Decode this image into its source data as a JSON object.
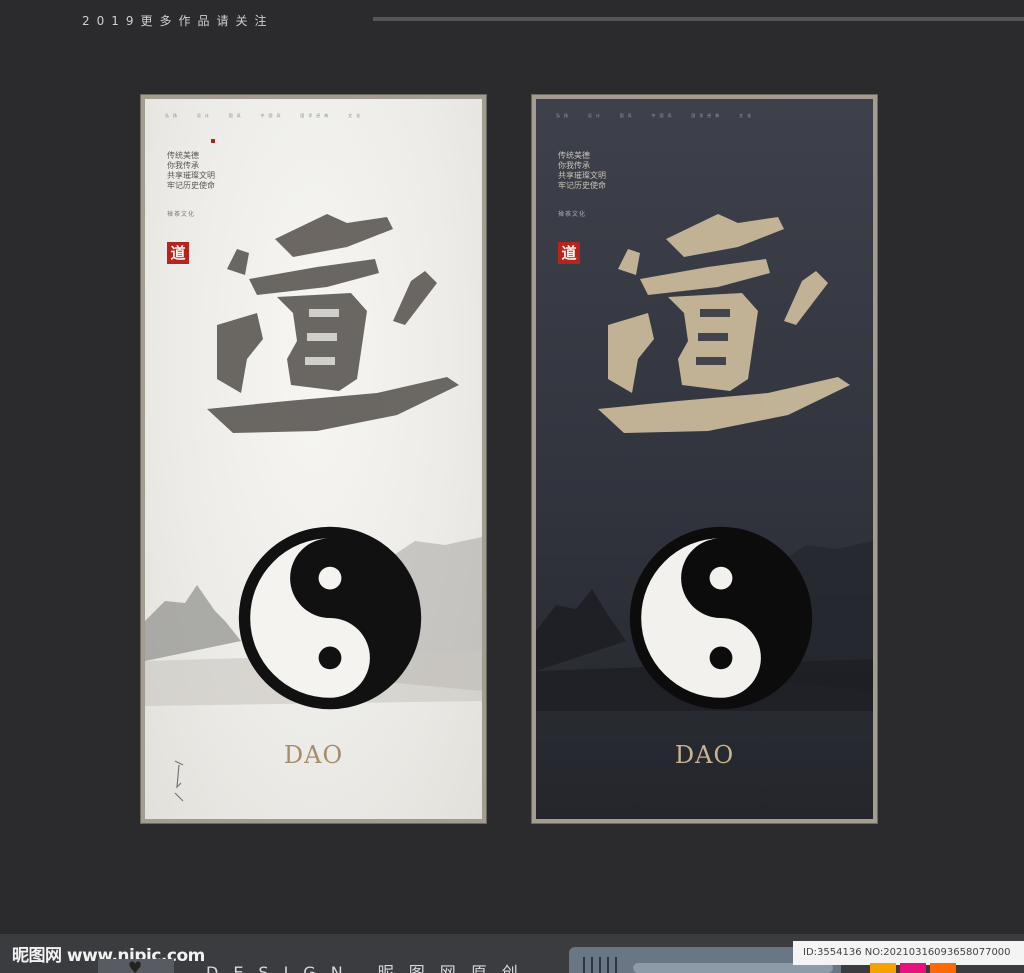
{
  "header": {
    "title": "2019更多作品请关注"
  },
  "posters": {
    "meta": "弘扬 · 设计 · 国风 · 中国风 · 国学经典 · 文化",
    "poem": [
      "传统美德",
      "你我传承",
      "共享璀璨文明",
      "牢记历史使命"
    ],
    "culture": "禅茶文化",
    "seal": "道",
    "big_glyph": "道",
    "title": "DAO",
    "colors": {
      "light_bg": "#ecebe7",
      "dark_bg": "#31343d",
      "seal_red": "#b8231d",
      "gold": "#c8b48f"
    }
  },
  "footer": {
    "brand": "昵图网 www.nipic.com",
    "design": "DESIGN 昵图网原创",
    "id_text": "ID:3554136 NO:20210316093658077000",
    "heart_icon": "heart-icon",
    "swatch_colors": [
      "#f5a100",
      "#e8127c",
      "#ff6a00"
    ]
  }
}
